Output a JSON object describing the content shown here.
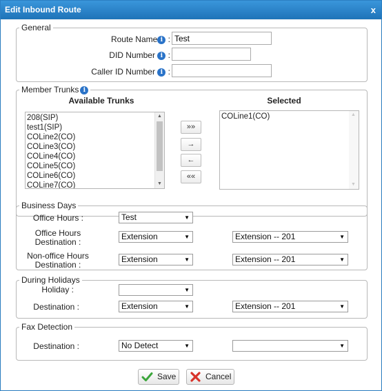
{
  "dialog": {
    "title": "Edit Inbound Route",
    "close_label": "x"
  },
  "general": {
    "legend": "General",
    "route_name_label": "Route Name",
    "route_name_value": "Test",
    "did_label": "DID Number",
    "did_value": "",
    "callerid_label": "Caller ID Number",
    "callerid_value": "",
    "colon": ":"
  },
  "trunks": {
    "legend": "Member Trunks",
    "available_header": "Available Trunks",
    "selected_header": "Selected",
    "available": [
      "208(SIP)",
      "test1(SIP)",
      "COLine2(CO)",
      "COLine3(CO)",
      "COLine4(CO)",
      "COLine5(CO)",
      "COLine6(CO)",
      "COLine7(CO)"
    ],
    "selected": [
      "COLine1(CO)"
    ],
    "buttons": {
      "add_all": "»»",
      "add": "→",
      "remove": "←",
      "remove_all": "««"
    }
  },
  "business": {
    "legend": "Business Days",
    "office_hours_label": "Office Hours :",
    "office_hours_value": "Test",
    "office_dest_label_1": "Office Hours",
    "office_dest_label_2": "Destination :",
    "office_dest_type": "Extension",
    "office_dest_target": "Extension -- 201",
    "nonoffice_label_1": "Non-office Hours",
    "nonoffice_label_2": "Destination :",
    "nonoffice_type": "Extension",
    "nonoffice_target": "Extension -- 201"
  },
  "holidays": {
    "legend": "During Holidays",
    "holiday_label": "Holiday :",
    "holiday_value": "",
    "dest_label": "Destination :",
    "dest_type": "Extension",
    "dest_target": "Extension -- 201"
  },
  "fax": {
    "legend": "Fax Detection",
    "dest_label": "Destination :",
    "dest_value": "No Detect",
    "dest_target": ""
  },
  "footer": {
    "save_label": "Save",
    "cancel_label": "Cancel"
  },
  "colors": {
    "title_bar": "#2a85cc",
    "info_icon": "#2a73c8",
    "save_icon": "#3aa53a",
    "cancel_icon": "#d8332a"
  }
}
